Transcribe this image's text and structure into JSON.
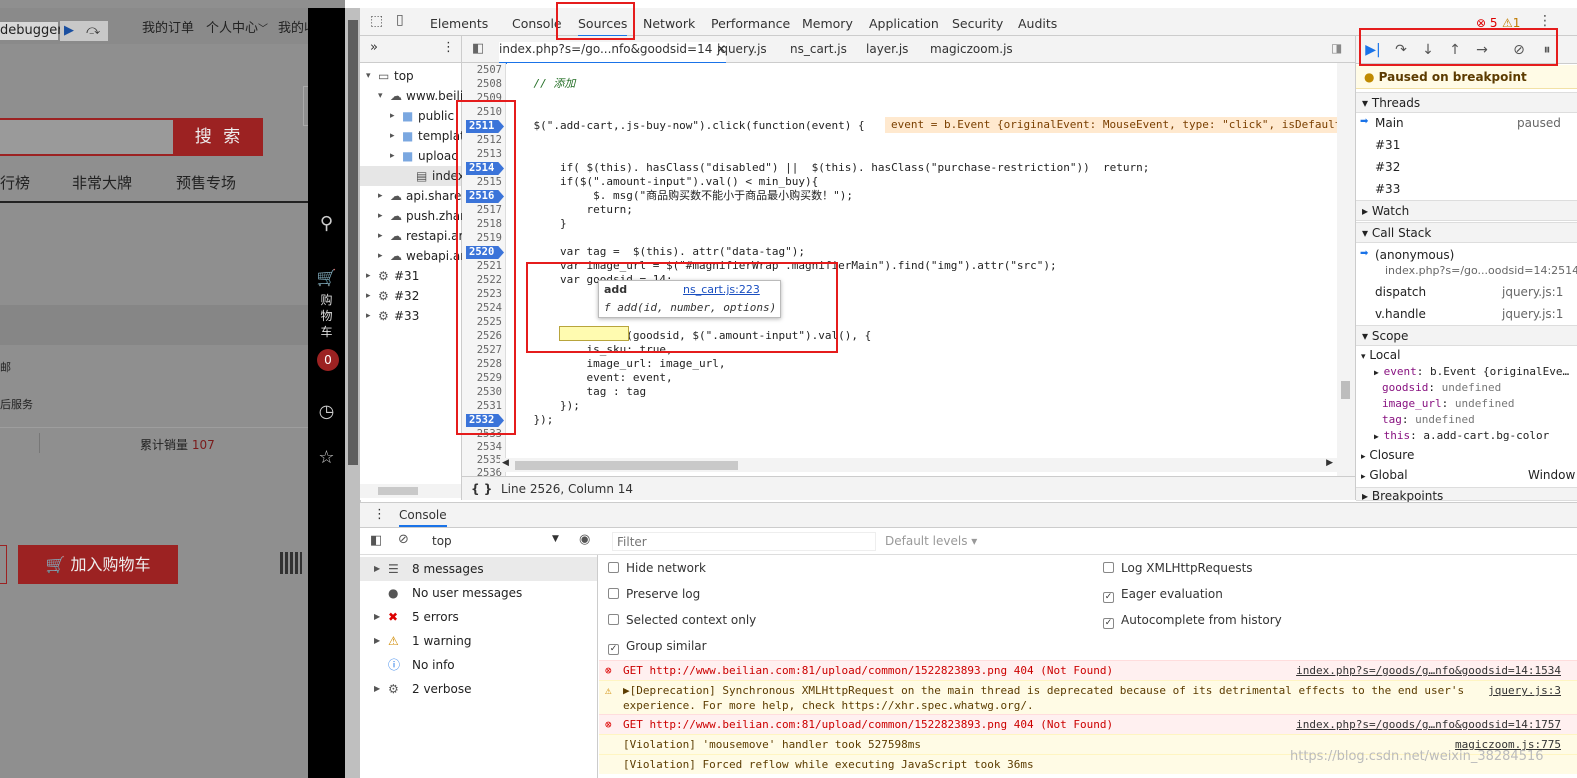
{
  "site": {
    "debugger_label": "debugger",
    "top_links": [
      "我的订单",
      "个人中心",
      "我的收"
    ],
    "search_button": "搜 索",
    "nav_items": [
      "行榜",
      "非常大牌",
      "预售专场"
    ],
    "side_labels": [
      "邮",
      "后服务"
    ],
    "sales_label": "累计销量",
    "sales_count": "107",
    "add_to_cart": "加入购物车",
    "side_cart_label": "购物车",
    "cart_count": "0"
  },
  "devtools": {
    "tabs": [
      "Elements",
      "Console",
      "Sources",
      "Network",
      "Performance",
      "Memory",
      "Application",
      "Security",
      "Audits"
    ],
    "active_tab": "Sources",
    "error_count": "5",
    "warning_count": "1",
    "nav_tree": [
      {
        "label": "top",
        "indent": 0
      },
      {
        "label": "www.beili",
        "indent": 1
      },
      {
        "label": "public",
        "indent": 2
      },
      {
        "label": "templat",
        "indent": 2
      },
      {
        "label": "uploac",
        "indent": 2
      },
      {
        "label": "index.p",
        "indent": 3
      },
      {
        "label": "api.share",
        "indent": 1
      },
      {
        "label": "push.zhar",
        "indent": 1
      },
      {
        "label": "restapi.ar",
        "indent": 1
      },
      {
        "label": "webapi.ar",
        "indent": 1
      },
      {
        "label": "#31",
        "indent": 0
      },
      {
        "label": "#32",
        "indent": 0
      },
      {
        "label": "#33",
        "indent": 0
      }
    ],
    "file_tabs": [
      "index.php?s=/go...nfo&goodsid=14",
      "jquery.js",
      "ns_cart.js",
      "layer.js",
      "magiczoom.js"
    ],
    "inline_value": "event = b.Event {originalEvent: MouseEvent, type: \"click\", isDefault",
    "tooltip_name": "add",
    "tooltip_link": "ns_cart.js:223",
    "tooltip_sig": "f add(id, number, options)",
    "status": "Line 2526, Column 14",
    "paused": "Paused on breakpoint",
    "threads_title": "Threads",
    "threads": [
      {
        "name": "Main",
        "state": "paused"
      },
      {
        "name": "#31",
        "state": ""
      },
      {
        "name": "#32",
        "state": ""
      },
      {
        "name": "#33",
        "state": ""
      }
    ],
    "watch_title": "Watch",
    "callstack_title": "Call Stack",
    "callstack": [
      {
        "name": "(anonymous)",
        "loc": "index.php?s=/go...oodsid=14:2514"
      },
      {
        "name": "dispatch",
        "loc": "jquery.js:1"
      },
      {
        "name": "v.handle",
        "loc": "jquery.js:1"
      }
    ],
    "scope_title": "Scope",
    "local_title": "Local",
    "scope_vars": [
      {
        "k": "event",
        "v": "b.Event {originalEve…"
      },
      {
        "k": "goodsid",
        "v": "undefined"
      },
      {
        "k": "image_url",
        "v": "undefined"
      },
      {
        "k": "tag",
        "v": "undefined"
      },
      {
        "k": "this",
        "v": "a.add-cart.bg-color"
      }
    ],
    "closure": "Closure",
    "global": "Global",
    "global_val": "Window",
    "breakpoints_title": "Breakpoints"
  },
  "code": {
    "line_numbers": [
      "2507",
      "2508",
      "2509",
      "2510",
      "2511",
      "2512",
      "2513",
      "2514",
      "2515",
      "2516",
      "2517",
      "2518",
      "2519",
      "2520",
      "2521",
      "2522",
      "2523",
      "2524",
      "2525",
      "2526",
      "2527",
      "2528",
      "2529",
      "2530",
      "2531",
      "2532",
      "2533",
      "2534",
      "2535",
      "2536"
    ],
    "breakpoint_lines": [
      "2511",
      "2514",
      "2516",
      "2520",
      "2532"
    ],
    "lines": [
      "",
      "    // 添加",
      "",
      "",
      "    $(\".add-cart,.js-buy-now\").click(function(event) {",
      "",
      "",
      "        if( $(this). hasClass(\"disabled\") ||  $(this). hasClass(\"purchase-restriction\"))  return; ",
      "        if($(\".amount-input\").val() < min_buy){",
      "             $. msg(\"商品购买数不能小于商品最小购买数！\");",
      "            return;",
      "        }",
      "",
      "        var tag =  $(this). attr(\"data-tag\");",
      "        var image_url = $(\"#magnifierWrap .magnifierMain\").find(\"img\").attr(\"src\");",
      "        var goodsid = 14;",
      "",
      "",
      "",
      "        $.cart.add(goodsid, $(\".amount-input\").val(), {",
      "            is_sku: true,",
      "            image_url: image_url,",
      "            event: event,",
      "            tag : tag",
      "        });",
      "    });",
      "",
      "",
      "",
      ""
    ]
  },
  "console": {
    "tab": "Console",
    "context": "top",
    "filter_placeholder": "Filter",
    "levels": "Default levels ▾",
    "sidebar": [
      {
        "icon": "list-icon",
        "label": "8 messages"
      },
      {
        "icon": "user-icon",
        "label": "No user messages"
      },
      {
        "icon": "error-icon",
        "label": "5 errors"
      },
      {
        "icon": "warning-icon",
        "label": "1 warning"
      },
      {
        "icon": "info-icon",
        "label": "No info"
      },
      {
        "icon": "bug-icon",
        "label": "2 verbose"
      }
    ],
    "options_left": [
      {
        "label": "Hide network",
        "checked": false
      },
      {
        "label": "Preserve log",
        "checked": false
      },
      {
        "label": "Selected context only",
        "checked": false
      },
      {
        "label": "Group similar",
        "checked": true
      }
    ],
    "options_right": [
      {
        "label": "Log XMLHttpRequests",
        "checked": false
      },
      {
        "label": "Eager evaluation",
        "checked": true
      },
      {
        "label": "Autocomplete from history",
        "checked": true
      }
    ],
    "messages": [
      {
        "type": "err",
        "text": "GET http://www.beilian.com:81/upload/common/1522823893.png 404 (Not Found)",
        "src": "index.php?s=/goods/g…nfo&goodsid=14:1534"
      },
      {
        "type": "warn",
        "text": "▶[Deprecation] Synchronous XMLHttpRequest on the main thread is deprecated because of its detrimental effects to the end user's",
        "src": "jquery.js:3"
      },
      {
        "type": "warn2",
        "text": "experience. For more help, check https://xhr.spec.whatwg.org/.",
        "src": ""
      },
      {
        "type": "err",
        "text": "GET http://www.beilian.com:81/upload/common/1522823893.png 404 (Not Found)",
        "src": "index.php?s=/goods/g…nfo&goodsid=14:1757"
      },
      {
        "type": "plain",
        "text": "[Violation] 'mousemove' handler took 527598ms",
        "src": "magiczoom.js:775"
      },
      {
        "type": "plain",
        "text": "[Violation] Forced reflow while executing JavaScript took 36ms",
        "src": ""
      }
    ],
    "watermark": "https://blog.csdn.net/weixin_38284516"
  },
  "colors": {
    "accent": "#1a73e8",
    "brand_red": "#9c2222",
    "annotation_red": "#e51c1c"
  }
}
